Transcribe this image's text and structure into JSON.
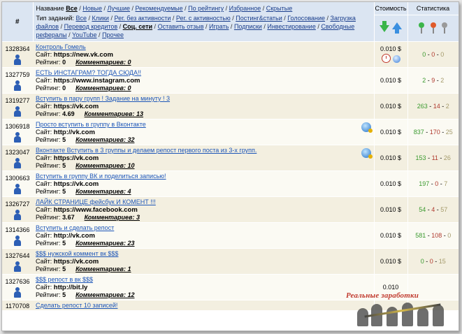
{
  "header": {
    "hash": "#",
    "name_label": "Название",
    "name_filters": [
      {
        "label": "Все",
        "selected": true
      },
      {
        "label": "Новые",
        "selected": false
      },
      {
        "label": "Лучшие",
        "selected": false
      },
      {
        "label": "Рекомендуемые",
        "selected": false
      },
      {
        "label": "По рейтингу",
        "selected": false
      },
      {
        "label": "Избранное",
        "selected": false
      },
      {
        "label": "Скрытые",
        "selected": false
      }
    ],
    "type_label": "Тип заданий:",
    "type_filters": [
      {
        "label": "Все",
        "selected": false
      },
      {
        "label": "Клики",
        "selected": false
      },
      {
        "label": "Рег. без активности",
        "selected": false
      },
      {
        "label": "Рег. с активностью",
        "selected": false
      },
      {
        "label": "Постинг&статьи",
        "selected": false
      },
      {
        "label": "Голосование",
        "selected": false
      },
      {
        "label": "Загрузка файлов",
        "selected": false
      },
      {
        "label": "Перевод кредитов",
        "selected": false
      },
      {
        "label": "Соц. сети",
        "selected": true
      },
      {
        "label": "Оставить отзыв",
        "selected": false
      },
      {
        "label": "Играть",
        "selected": false
      },
      {
        "label": "Подписки",
        "selected": false
      },
      {
        "label": "Инвестирование",
        "selected": false
      },
      {
        "label": "Свободные рефералы",
        "selected": false
      },
      {
        "label": "YouTube",
        "selected": false
      },
      {
        "label": "Прочее",
        "selected": false
      }
    ],
    "cost_label": "Стоимость",
    "stats_label": "Статистика",
    "colors": {
      "header_bg": "#dbe5f2",
      "pin_green": "#3cb54a",
      "pin_red": "#e05a2a",
      "pin_gray": "#9a9a9a"
    }
  },
  "rows": [
    {
      "id": "1328364",
      "title": "Контроль Гомель",
      "site_label": "Сайт:",
      "site": "https://new.vk.com",
      "rating_label": "Рейтинг:",
      "rating": "0",
      "comments": "Комментариев: 0",
      "cost": "0.010 $",
      "cost_icons": true,
      "globe": false,
      "stat_g": "0",
      "stat_r": "0",
      "stat_y": "0"
    },
    {
      "id": "1327759",
      "title": "ЕСТЬ ИНСТАГРАМ? ТОГДА СЮДА!!",
      "site_label": "Сайт:",
      "site": "https://www.instagram.com",
      "rating_label": "Рейтинг:",
      "rating": "0",
      "comments": "Комментариев: 0",
      "cost": "0.010 $",
      "cost_icons": false,
      "globe": false,
      "stat_g": "2",
      "stat_r": "9",
      "stat_y": "2"
    },
    {
      "id": "1319277",
      "title": "Вступить в пару групп ! Задание на минуту ! 3",
      "site_label": "Сайт:",
      "site": "https://vk.com",
      "rating_label": "Рейтинг:",
      "rating": "4.69",
      "comments": "Комментариев: 13",
      "cost": "0.010 $",
      "cost_icons": false,
      "globe": false,
      "stat_g": "263",
      "stat_r": "14",
      "stat_y": "2"
    },
    {
      "id": "1306918",
      "title": "Просто вступить в группу в Вконтакте",
      "site_label": "Сайт:",
      "site": "http://vk.com",
      "rating_label": "Рейтинг:",
      "rating": "5",
      "comments": "Комментариев: 32",
      "cost": "0.010 $",
      "cost_icons": false,
      "globe": true,
      "stat_g": "837",
      "stat_r": "170",
      "stat_y": "25"
    },
    {
      "id": "1323047",
      "title": "Вконтакте Вступить в 3 группы и делаем репост первого поста из 3-х групп.",
      "site_label": "Сайт:",
      "site": "https://vk.com",
      "rating_label": "Рейтинг:",
      "rating": "5",
      "comments": "Комментариев: 10",
      "cost": "0.010 $",
      "cost_icons": false,
      "globe": true,
      "stat_g": "153",
      "stat_r": "11",
      "stat_y": "26"
    },
    {
      "id": "1300663",
      "title": "Вступить в группу ВК и поделиться записью!",
      "site_label": "Сайт:",
      "site": "https://vk.com",
      "rating_label": "Рейтинг:",
      "rating": "5",
      "comments": "Комментариев: 4",
      "cost": "0.010 $",
      "cost_icons": false,
      "globe": false,
      "stat_g": "197",
      "stat_r": "0",
      "stat_y": "7"
    },
    {
      "id": "1326727",
      "title": "ЛАЙК СТРАНИЦЕ фейсбук И КОМЕНТ !!!",
      "site_label": "Сайт:",
      "site": "https://www.facebook.com",
      "rating_label": "Рейтинг:",
      "rating": "3.67",
      "comments": "Комментариев: 3",
      "cost": "0.010 $",
      "cost_icons": false,
      "globe": false,
      "stat_g": "54",
      "stat_r": "4",
      "stat_y": "57"
    },
    {
      "id": "1314366",
      "title": "Вступить и сделать репост",
      "site_label": "Сайт:",
      "site": "http://vk.com",
      "rating_label": "Рейтинг:",
      "rating": "5",
      "comments": "Комментариев: 23",
      "cost": "0.010 $",
      "cost_icons": false,
      "globe": false,
      "stat_g": "581",
      "stat_r": "108",
      "stat_y": "0"
    },
    {
      "id": "1327644",
      "title": "$$$ нужской коммент вк $$$",
      "site_label": "Сайт:",
      "site": "https://vk.com",
      "rating_label": "Рейтинг:",
      "rating": "5",
      "comments": "Комментариев: 1",
      "cost": "0.010 $",
      "cost_icons": false,
      "globe": false,
      "stat_g": "0",
      "stat_r": "0",
      "stat_y": "15"
    },
    {
      "id": "1327636",
      "title": "$$$ репост в вк $$$",
      "site_label": "Сайт:",
      "site": "http://bit.ly",
      "rating_label": "Рейтинг:",
      "rating": "5",
      "comments": "Комментариев: 12",
      "cost": "0.010",
      "cost_icons": false,
      "globe": false,
      "stat_g": "",
      "stat_r": "",
      "stat_y": ""
    }
  ],
  "last_row": {
    "id": "1170708",
    "title": "Сделать репост 10 записей!"
  },
  "watermark": {
    "text": "Реальные заработки"
  }
}
